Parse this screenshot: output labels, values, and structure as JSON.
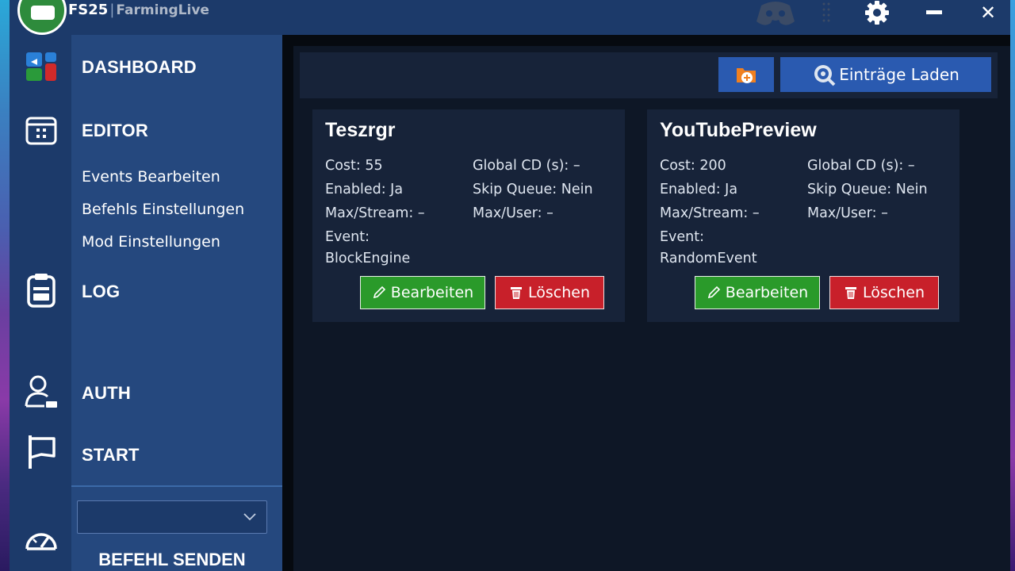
{
  "app": {
    "brand": "FS25",
    "brand_separator": "|",
    "brand_sub": "FarmingLive"
  },
  "titlebar_icons": [
    "discord-icon",
    "grip-icon",
    "gear-icon",
    "minimize-icon",
    "close-icon"
  ],
  "titlebar": {
    "close_glyph": "✕"
  },
  "nav": {
    "items": [
      {
        "label": "DASHBOARD",
        "icon": "dashboard-icon"
      },
      {
        "label": "EDITOR",
        "icon": "calendar-icon"
      },
      {
        "label": "LOG",
        "icon": "clipboard-icon"
      },
      {
        "label": "AUTH",
        "icon": "user-icon"
      },
      {
        "label": "START",
        "icon": "flag-icon"
      }
    ],
    "subitems": [
      "Events Bearbeiten",
      "Befehls Einstellungen",
      "Mod Einstellungen"
    ],
    "command_select_value": "",
    "send_label": "BEFEHL SENDEN",
    "bottom_icon": "speedometer-icon"
  },
  "toolbar": {
    "add_icon": "folder-add-icon",
    "load_label": "Einträge Laden",
    "load_icon": "load-search-icon"
  },
  "cards": [
    {
      "title": "Teszrgr",
      "cost": "Cost: 55",
      "enabled": "Enabled: Ja",
      "max_stream": "Max/Stream: –",
      "event_label": "Event:",
      "event_value": "BlockEngine",
      "global_cd": "Global CD (s): –",
      "skip_queue": "Skip Queue: Nein",
      "max_user": "Max/User: –",
      "edit_label": "Bearbeiten",
      "delete_label": "Löschen"
    },
    {
      "title": "YouTubePreview",
      "cost": "Cost: 200",
      "enabled": "Enabled: Ja",
      "max_stream": "Max/Stream: –",
      "event_label": "Event:",
      "event_value": "RandomEvent",
      "global_cd": "Global CD (s): –",
      "skip_queue": "Skip Queue: Nein",
      "max_user": "Max/User: –",
      "edit_label": "Bearbeiten",
      "delete_label": "Löschen"
    }
  ],
  "colors": {
    "titlebar": "#1c3a6a",
    "nav": "#25487e",
    "accent_button": "#2a5ab0",
    "edit_green": "#2a9a2a",
    "delete_red": "#c8202a",
    "card_bg": "#172339"
  }
}
